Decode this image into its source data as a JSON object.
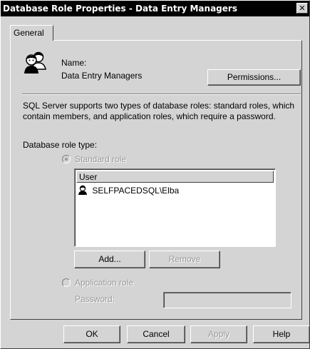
{
  "window": {
    "title": "Database Role Properties - Data Entry Managers",
    "close_glyph": "✕"
  },
  "tabs": [
    {
      "label": "General",
      "active": true
    }
  ],
  "general": {
    "role_icon": "users-group-icon",
    "name_label": "Name:",
    "name_value": "Data Entry Managers",
    "permissions_button": "Permissions...",
    "description": "SQL Server supports two types of database roles: standard roles, which contain members, and application roles, which require a password.",
    "role_type_label": "Database role type:",
    "standard_role": {
      "label": "Standard role",
      "selected": true,
      "enabled": false
    },
    "members": {
      "column_header": "User",
      "rows": [
        {
          "icon": "user-icon",
          "name": "SELFPACEDSQL\\Elba"
        }
      ],
      "add_button": "Add...",
      "remove_button": "Remove"
    },
    "application_role": {
      "label": "Application role",
      "selected": false,
      "enabled": false,
      "password_label": "Password:",
      "password_value": ""
    }
  },
  "footer": {
    "ok": "OK",
    "cancel": "Cancel",
    "apply": "Apply",
    "help": "Help"
  },
  "colors": {
    "dialog_face": "#d4d4d4",
    "titlebar": "#000000",
    "disabled_text": "#9a9a9a"
  }
}
